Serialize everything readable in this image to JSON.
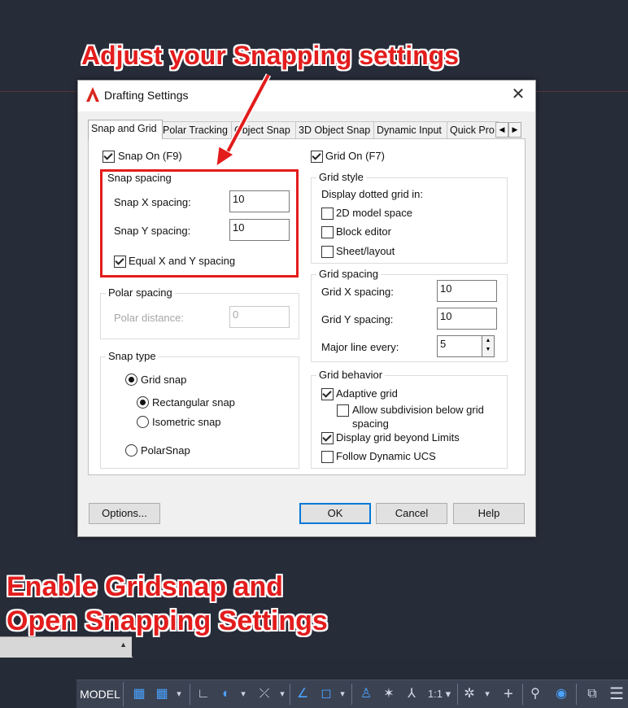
{
  "annotations": {
    "top": "Adjust your Snapping settings",
    "bottom_line1": "Enable Gridsnap and",
    "bottom_line2": "Open Snapping Settings"
  },
  "dialog": {
    "title": "Drafting Settings",
    "close_glyph": "✕",
    "tabs": [
      "Snap and Grid",
      "Polar Tracking",
      "Object Snap",
      "3D Object Snap",
      "Dynamic Input",
      "Quick Pro"
    ],
    "active_tab": "Snap and Grid",
    "tab_scroll_left": "◀",
    "tab_scroll_right": "▶",
    "snap_on": {
      "label": "Snap On (F9)",
      "checked": true
    },
    "grid_on": {
      "label": "Grid On (F7)",
      "checked": true
    },
    "snap_spacing": {
      "title": "Snap spacing",
      "x_label": "Snap X spacing:",
      "x_value": "10",
      "y_label": "Snap Y spacing:",
      "y_value": "10",
      "equal_label": "Equal X and Y spacing",
      "equal_checked": true
    },
    "polar_spacing": {
      "title": "Polar spacing",
      "distance_label": "Polar distance:",
      "distance_value": "0"
    },
    "snap_type": {
      "title": "Snap type",
      "grid_snap": "Grid snap",
      "rectangular_snap": "Rectangular snap",
      "isometric_snap": "Isometric snap",
      "polar_snap": "PolarSnap"
    },
    "grid_style": {
      "title": "Grid style",
      "display_label": "Display dotted grid in:",
      "model_space": "2D model space",
      "block_editor": "Block editor",
      "sheet_layout": "Sheet/layout"
    },
    "grid_spacing": {
      "title": "Grid spacing",
      "x_label": "Grid X spacing:",
      "x_value": "10",
      "y_label": "Grid Y spacing:",
      "y_value": "10",
      "major_label": "Major line every:",
      "major_value": "5"
    },
    "grid_behavior": {
      "title": "Grid behavior",
      "adaptive": "Adaptive grid",
      "subdivision_line1": "Allow subdivision below grid",
      "subdivision_line2": "spacing",
      "beyond_limits": "Display grid beyond Limits",
      "follow_ucs": "Follow Dynamic UCS"
    },
    "buttons": {
      "options": "Options...",
      "ok": "OK",
      "cancel": "Cancel",
      "help": "Help"
    }
  },
  "statusbar": {
    "model": "MODEL",
    "scale": "1:1 ▾"
  },
  "colors": {
    "annotation_red": "#e31c1c",
    "canvas_bg": "#272c39",
    "status_blue": "#4aa3ff"
  }
}
